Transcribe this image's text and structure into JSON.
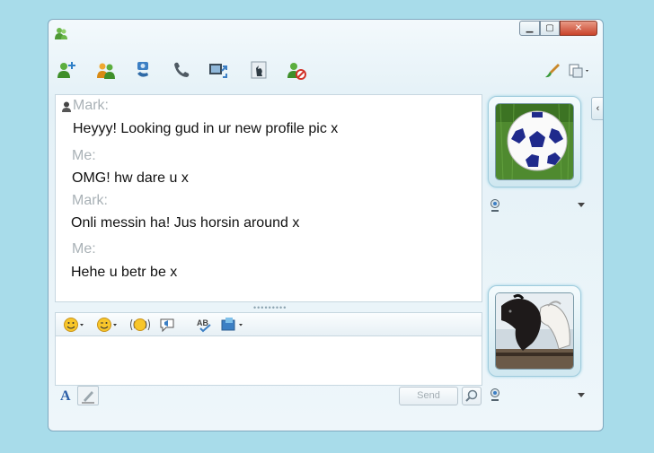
{
  "window": {
    "controls": {
      "minimize": "▁",
      "maximize": "▢",
      "close": "✕"
    }
  },
  "toolbar": {
    "icons": [
      "add-contact-icon",
      "contacts-group-icon",
      "video-call-icon",
      "voice-call-icon",
      "share-files-icon",
      "games-icon",
      "block-contact-icon"
    ],
    "right_icons": [
      "paintbrush-icon",
      "menu-icon"
    ]
  },
  "conversation": {
    "messages": [
      {
        "sender": "Mark:",
        "text": "Heyyy! Looking gud in ur new profile pic x"
      },
      {
        "sender": "Me:",
        "text": "OMG! hw dare u x"
      },
      {
        "sender": "Mark:",
        "text": "Onli messin ha! Jus horsin around x"
      },
      {
        "sender": "Me:",
        "text": "Hehe u betr be x"
      }
    ]
  },
  "format_bar": {
    "icons": [
      "emoticon-icon",
      "wink-icon",
      "nudge-icon",
      "voice-clip-icon",
      "spellcheck-icon",
      "background-icon"
    ]
  },
  "compose": {
    "font_label": "A",
    "send_label": "Send"
  },
  "avatars": {
    "contact": "soccer-ball-picture",
    "self": "horses-picture"
  },
  "colors": {
    "background": "#a8dcea",
    "sender_gray": "#a9b1b6",
    "accent": "#2c5fa8"
  }
}
